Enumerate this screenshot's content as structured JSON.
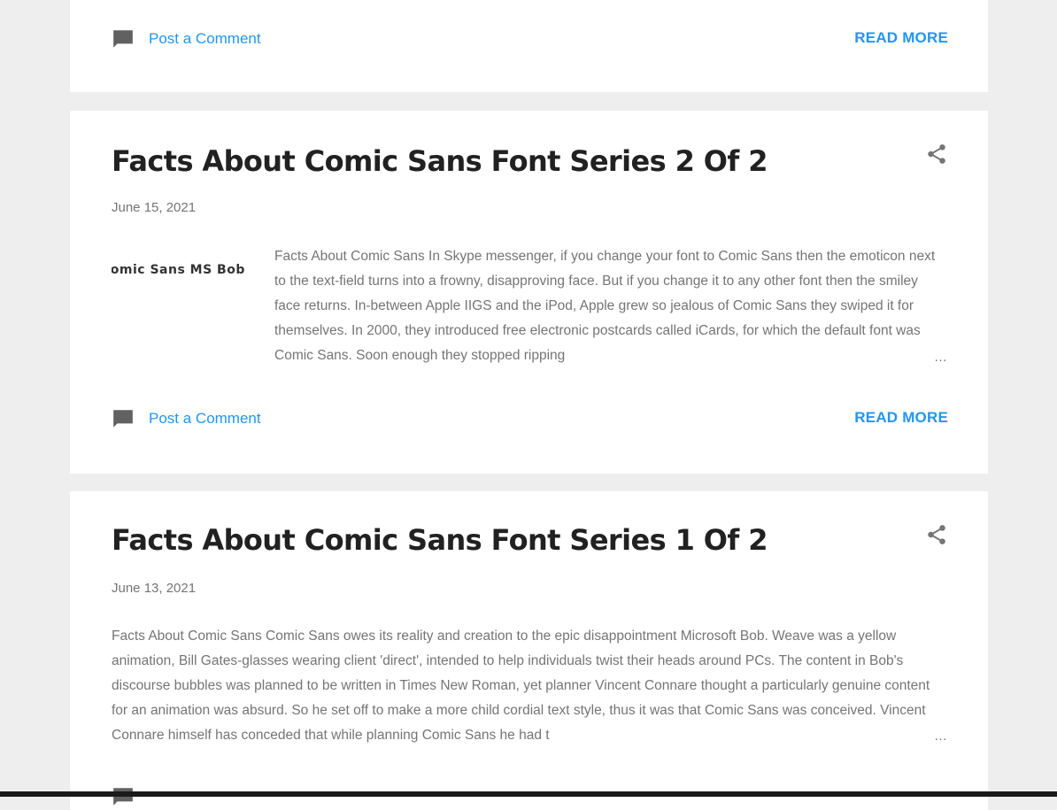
{
  "colors": {
    "page_background": "#eeeeee",
    "card_background": "#ffffff",
    "title_text": "#212121",
    "muted_text": "#757575",
    "link_accent": "#2196f3"
  },
  "posts": [
    {
      "comment_label": "Post a Comment",
      "read_more_label": "READ MORE"
    },
    {
      "title": "Facts About Comic Sans Font Series 2 Of 2",
      "date": "June 15, 2021",
      "thumbnail_text": "Comic Sans MS Bob",
      "snippet": " Facts About Comic Sans In Skype messenger, if you change your font to Comic Sans then the emoticon next to the text-field turns into a frowny, disapproving face. But if you change it to any other font then the smiley face returns. In-between Apple IIGS and the iPod, Apple grew so jealous of Comic Sans they swiped it for themselves. In 2000, they introduced free electronic postcards called iCards, for which the default font was Comic Sans. Soon enough they stopped ripping",
      "ellipsis": "…",
      "comment_label": "Post a Comment",
      "read_more_label": "READ MORE",
      "share_icon": "share-icon",
      "comment_icon": "comment-icon"
    },
    {
      "title": "Facts About Comic Sans Font Series 1 Of 2",
      "date": "June 13, 2021",
      "snippet": " Facts About Comic Sans Comic Sans owes its reality and creation to the epic disappointment Microsoft Bob. Weave was a yellow animation, Bill Gates-glasses wearing client 'direct', intended to help individuals twist their heads around PCs. The content in Bob's discourse bubbles was planned to be written in Times New Roman, yet planner Vincent Connare thought a particularly genuine content for an animation was absurd. So he set off to make a more child cordial text style, thus it was that Comic Sans was conceived.  Vincent Connare himself has conceded that while planning Comic Sans he had t",
      "ellipsis": "…",
      "share_icon": "share-icon"
    }
  ]
}
